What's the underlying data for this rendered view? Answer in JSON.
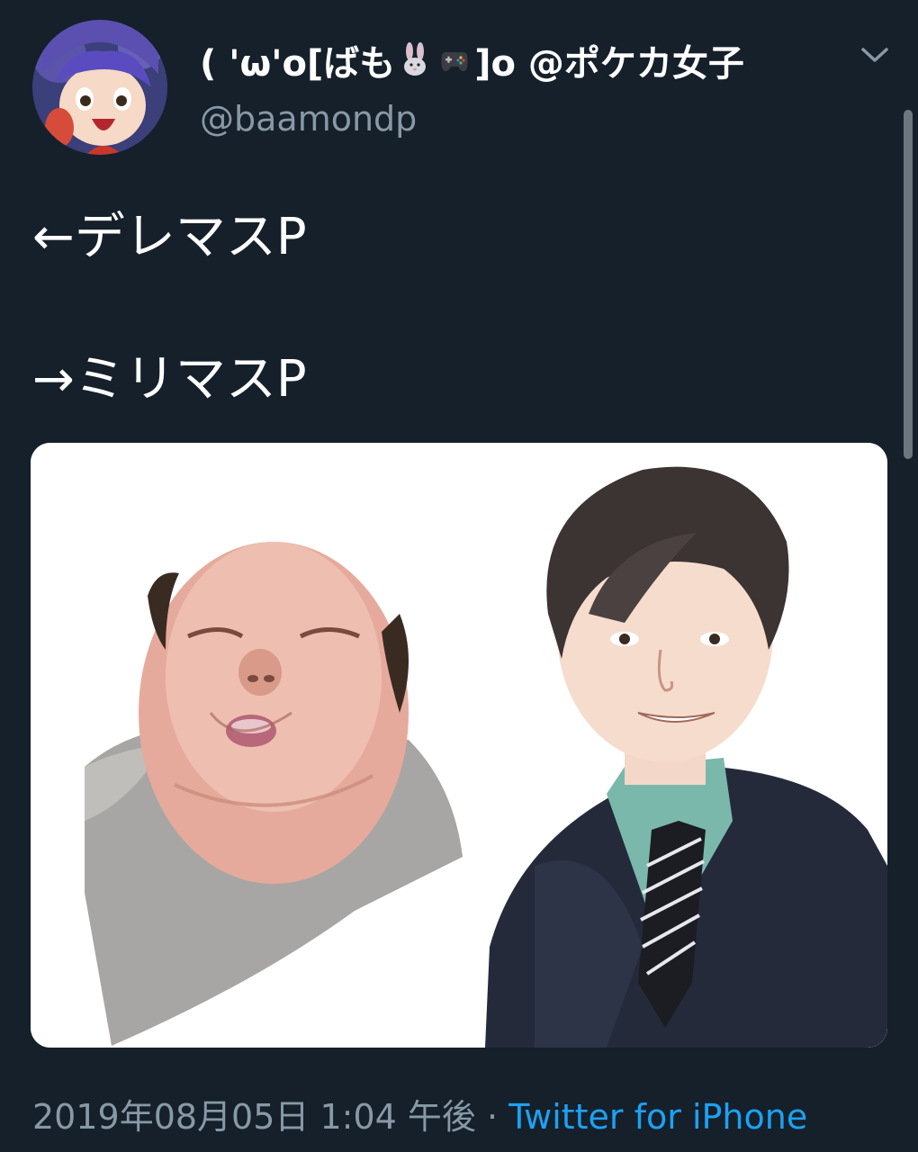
{
  "author": {
    "display_name_prefix": "( 'ω'o[ばも",
    "display_name_suffix": "]o @ポケカ女子",
    "handle": "@baamondp"
  },
  "tweet": {
    "lines": [
      "←デレマスP",
      "→ミリマスP"
    ]
  },
  "meta": {
    "timestamp": "2019年08月05日 1:04 午後",
    "separator": "·",
    "source": "Twitter for iPhone"
  },
  "icons": {
    "menu": "chevron-down-icon",
    "emoji1": "rabbit-icon",
    "emoji2": "game-controller-icon"
  },
  "colors": {
    "background": "#15202b",
    "text": "#ffffff",
    "muted": "#8899a6",
    "link": "#1da1f2"
  }
}
